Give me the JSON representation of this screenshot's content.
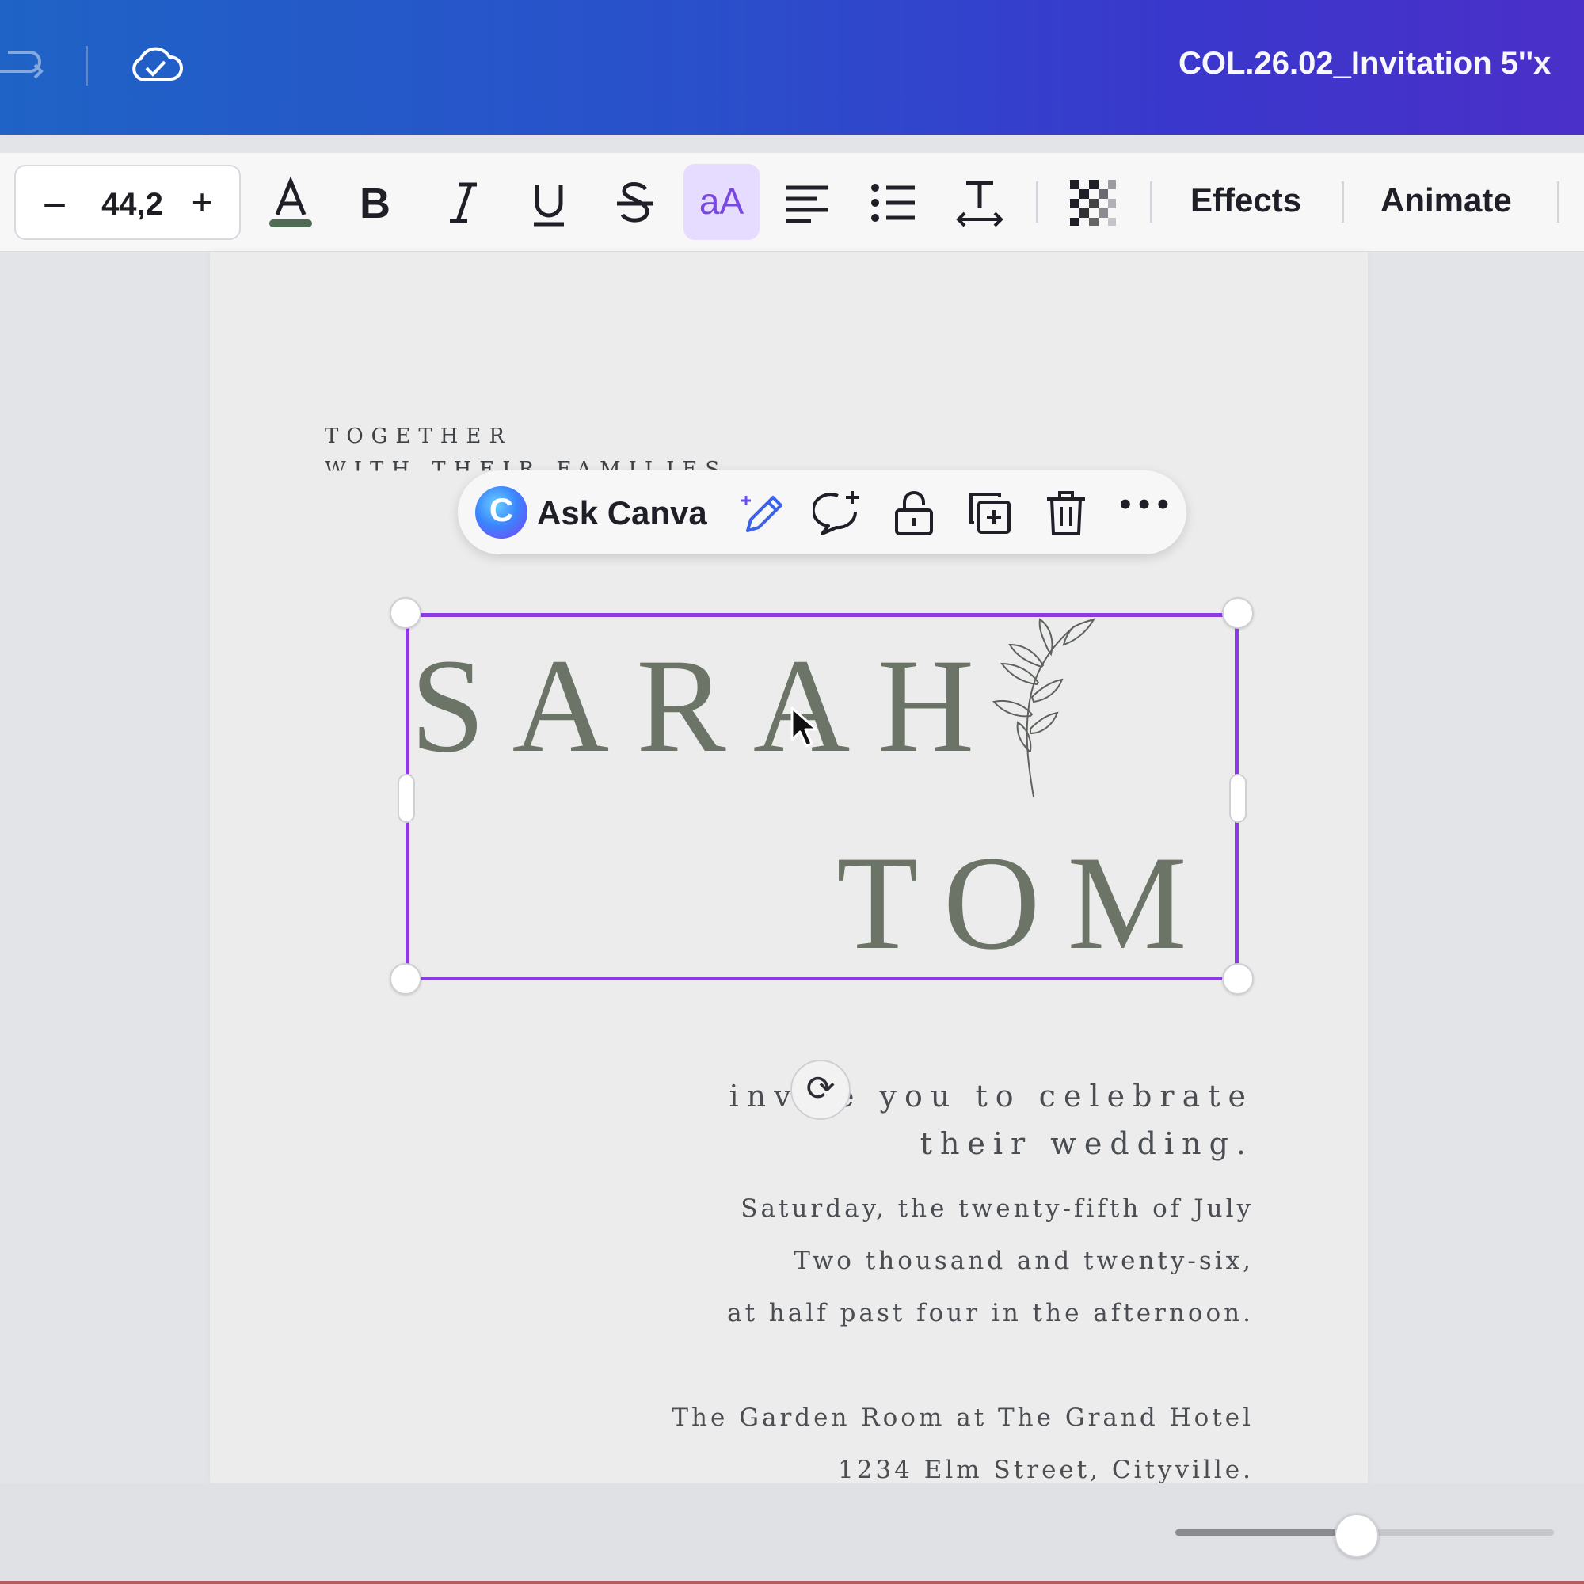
{
  "header": {
    "doc_title": "COL.26.02_Invitation 5''x"
  },
  "toolbar": {
    "font_size_value": "44,2",
    "minus_label": "–",
    "plus_label": "+",
    "case_label": "aA",
    "effects_label": "Effects",
    "animate_label": "Animate",
    "text_color": "#4f6b54"
  },
  "context_menu": {
    "ask_label": "Ask Canva",
    "logo_letter": "C",
    "more_label": "•••"
  },
  "invitation": {
    "top_line_1": "TOGETHER",
    "top_line_2": "WITH THEIR FAMILIES",
    "name_1": "SARAH",
    "name_2": "TOM",
    "invite_line_1": "invite you to celebrate",
    "invite_line_2": "their wedding.",
    "date_line_1": "Saturday, the twenty-fifth of July",
    "date_line_2": "Two thousand and twenty-six,",
    "date_line_3": "at half past four in the afternoon.",
    "venue_line_1": "The Garden Room at The Grand Hotel",
    "venue_line_2": "1234 Elm Street, Cityville."
  },
  "selection": {
    "rotate_glyph": "⟳"
  },
  "zoom": {
    "slider_fraction": 0.48
  },
  "colors": {
    "accent": "#8c3be3",
    "name_color": "#6b7466",
    "case_highlight": "#e5dcff"
  }
}
